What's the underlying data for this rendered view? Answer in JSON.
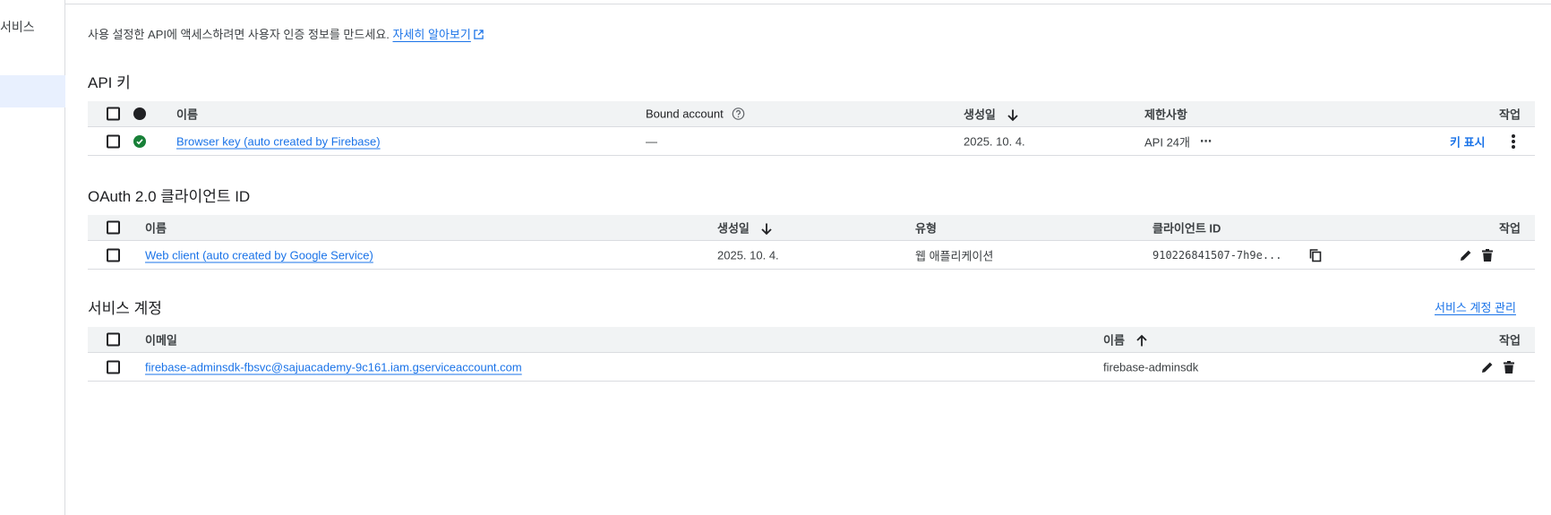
{
  "sidebar": {
    "label": "서비스"
  },
  "intro": {
    "text": "사용 설정한 API에 액세스하려면 사용자 인증 정보를 만드세요.",
    "link": "자세히 알아보기"
  },
  "api_keys": {
    "title": "API 키",
    "headers": {
      "name": "이름",
      "bound_account": "Bound account",
      "created": "생성일",
      "restrictions": "제한사항",
      "actions": "작업"
    },
    "rows": [
      {
        "name": "Browser key (auto created by Firebase)",
        "bound_account": "—",
        "created": "2025. 10. 4.",
        "restrictions": "API 24개",
        "show_key": "키 표시"
      }
    ]
  },
  "oauth": {
    "title": "OAuth 2.0 클라이언트 ID",
    "headers": {
      "name": "이름",
      "created": "생성일",
      "type": "유형",
      "client_id": "클라이언트 ID",
      "actions": "작업"
    },
    "rows": [
      {
        "name": "Web client (auto created by Google Service)",
        "created": "2025. 10. 4.",
        "type": "웹 애플리케이션",
        "client_id": "910226841507-7h9e..."
      }
    ]
  },
  "service_accounts": {
    "title": "서비스 계정",
    "manage_link": "서비스 계정 관리",
    "headers": {
      "email": "이메일",
      "name": "이름",
      "actions": "작업"
    },
    "rows": [
      {
        "email": "firebase-adminsdk-fbsvc@sajuacademy-9c161.iam.gserviceaccount.com",
        "name": "firebase-adminsdk"
      }
    ]
  },
  "colors": {
    "link": "#1a73e8",
    "header_bg": "#f1f3f4",
    "active_sidebar": "#e8f0fe",
    "ok_green": "#188038"
  }
}
